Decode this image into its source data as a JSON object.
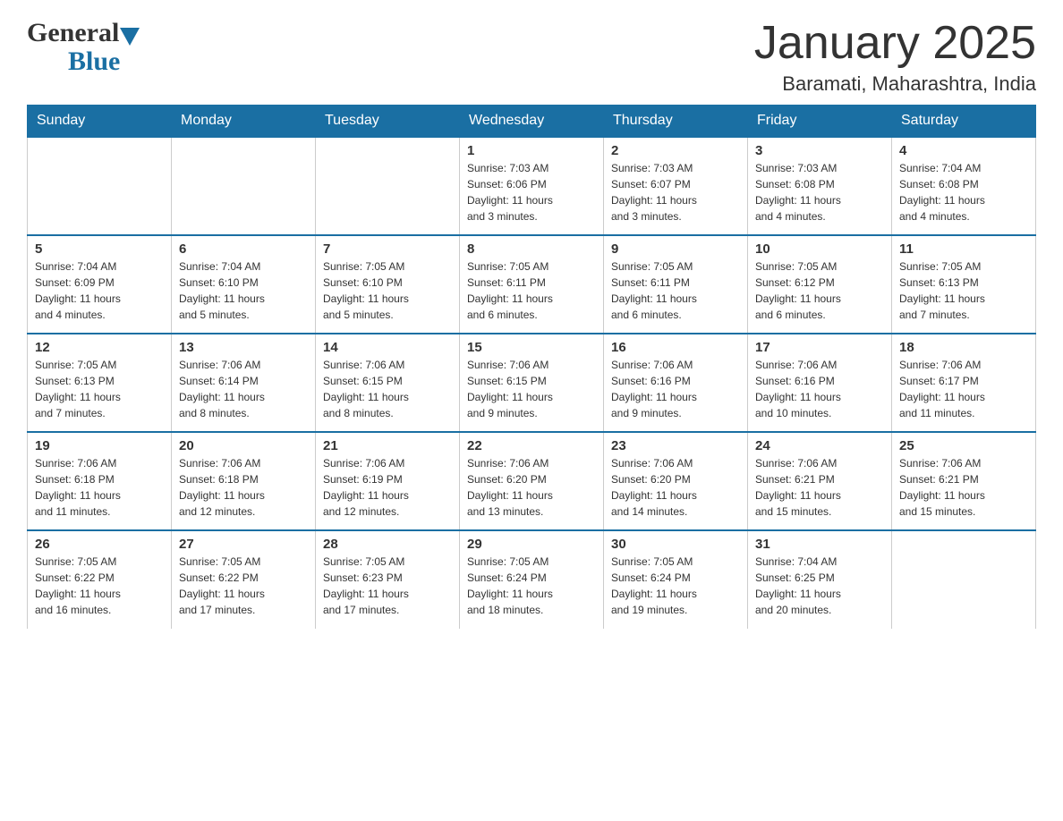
{
  "header": {
    "logo_line1": "General",
    "logo_blue": "Blue",
    "title": "January 2025",
    "location": "Baramati, Maharashtra, India"
  },
  "days_of_week": [
    "Sunday",
    "Monday",
    "Tuesday",
    "Wednesday",
    "Thursday",
    "Friday",
    "Saturday"
  ],
  "weeks": [
    [
      {
        "day": "",
        "info": ""
      },
      {
        "day": "",
        "info": ""
      },
      {
        "day": "",
        "info": ""
      },
      {
        "day": "1",
        "info": "Sunrise: 7:03 AM\nSunset: 6:06 PM\nDaylight: 11 hours\nand 3 minutes."
      },
      {
        "day": "2",
        "info": "Sunrise: 7:03 AM\nSunset: 6:07 PM\nDaylight: 11 hours\nand 3 minutes."
      },
      {
        "day": "3",
        "info": "Sunrise: 7:03 AM\nSunset: 6:08 PM\nDaylight: 11 hours\nand 4 minutes."
      },
      {
        "day": "4",
        "info": "Sunrise: 7:04 AM\nSunset: 6:08 PM\nDaylight: 11 hours\nand 4 minutes."
      }
    ],
    [
      {
        "day": "5",
        "info": "Sunrise: 7:04 AM\nSunset: 6:09 PM\nDaylight: 11 hours\nand 4 minutes."
      },
      {
        "day": "6",
        "info": "Sunrise: 7:04 AM\nSunset: 6:10 PM\nDaylight: 11 hours\nand 5 minutes."
      },
      {
        "day": "7",
        "info": "Sunrise: 7:05 AM\nSunset: 6:10 PM\nDaylight: 11 hours\nand 5 minutes."
      },
      {
        "day": "8",
        "info": "Sunrise: 7:05 AM\nSunset: 6:11 PM\nDaylight: 11 hours\nand 6 minutes."
      },
      {
        "day": "9",
        "info": "Sunrise: 7:05 AM\nSunset: 6:11 PM\nDaylight: 11 hours\nand 6 minutes."
      },
      {
        "day": "10",
        "info": "Sunrise: 7:05 AM\nSunset: 6:12 PM\nDaylight: 11 hours\nand 6 minutes."
      },
      {
        "day": "11",
        "info": "Sunrise: 7:05 AM\nSunset: 6:13 PM\nDaylight: 11 hours\nand 7 minutes."
      }
    ],
    [
      {
        "day": "12",
        "info": "Sunrise: 7:05 AM\nSunset: 6:13 PM\nDaylight: 11 hours\nand 7 minutes."
      },
      {
        "day": "13",
        "info": "Sunrise: 7:06 AM\nSunset: 6:14 PM\nDaylight: 11 hours\nand 8 minutes."
      },
      {
        "day": "14",
        "info": "Sunrise: 7:06 AM\nSunset: 6:15 PM\nDaylight: 11 hours\nand 8 minutes."
      },
      {
        "day": "15",
        "info": "Sunrise: 7:06 AM\nSunset: 6:15 PM\nDaylight: 11 hours\nand 9 minutes."
      },
      {
        "day": "16",
        "info": "Sunrise: 7:06 AM\nSunset: 6:16 PM\nDaylight: 11 hours\nand 9 minutes."
      },
      {
        "day": "17",
        "info": "Sunrise: 7:06 AM\nSunset: 6:16 PM\nDaylight: 11 hours\nand 10 minutes."
      },
      {
        "day": "18",
        "info": "Sunrise: 7:06 AM\nSunset: 6:17 PM\nDaylight: 11 hours\nand 11 minutes."
      }
    ],
    [
      {
        "day": "19",
        "info": "Sunrise: 7:06 AM\nSunset: 6:18 PM\nDaylight: 11 hours\nand 11 minutes."
      },
      {
        "day": "20",
        "info": "Sunrise: 7:06 AM\nSunset: 6:18 PM\nDaylight: 11 hours\nand 12 minutes."
      },
      {
        "day": "21",
        "info": "Sunrise: 7:06 AM\nSunset: 6:19 PM\nDaylight: 11 hours\nand 12 minutes."
      },
      {
        "day": "22",
        "info": "Sunrise: 7:06 AM\nSunset: 6:20 PM\nDaylight: 11 hours\nand 13 minutes."
      },
      {
        "day": "23",
        "info": "Sunrise: 7:06 AM\nSunset: 6:20 PM\nDaylight: 11 hours\nand 14 minutes."
      },
      {
        "day": "24",
        "info": "Sunrise: 7:06 AM\nSunset: 6:21 PM\nDaylight: 11 hours\nand 15 minutes."
      },
      {
        "day": "25",
        "info": "Sunrise: 7:06 AM\nSunset: 6:21 PM\nDaylight: 11 hours\nand 15 minutes."
      }
    ],
    [
      {
        "day": "26",
        "info": "Sunrise: 7:05 AM\nSunset: 6:22 PM\nDaylight: 11 hours\nand 16 minutes."
      },
      {
        "day": "27",
        "info": "Sunrise: 7:05 AM\nSunset: 6:22 PM\nDaylight: 11 hours\nand 17 minutes."
      },
      {
        "day": "28",
        "info": "Sunrise: 7:05 AM\nSunset: 6:23 PM\nDaylight: 11 hours\nand 17 minutes."
      },
      {
        "day": "29",
        "info": "Sunrise: 7:05 AM\nSunset: 6:24 PM\nDaylight: 11 hours\nand 18 minutes."
      },
      {
        "day": "30",
        "info": "Sunrise: 7:05 AM\nSunset: 6:24 PM\nDaylight: 11 hours\nand 19 minutes."
      },
      {
        "day": "31",
        "info": "Sunrise: 7:04 AM\nSunset: 6:25 PM\nDaylight: 11 hours\nand 20 minutes."
      },
      {
        "day": "",
        "info": ""
      }
    ]
  ],
  "accent_color": "#1a6fa3"
}
